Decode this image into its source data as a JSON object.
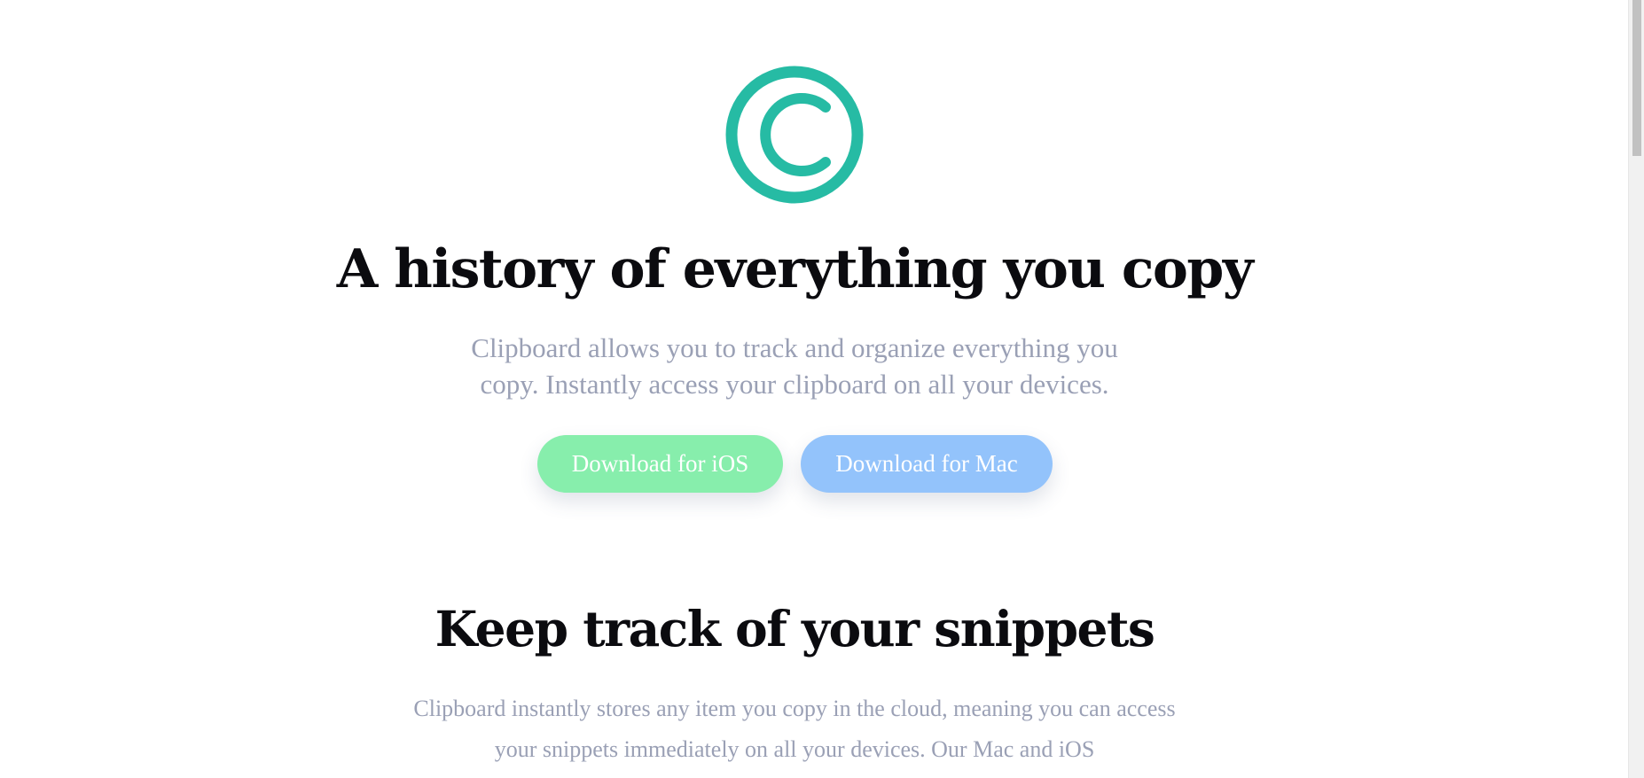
{
  "hero": {
    "logo_icon": "copyright-c-icon",
    "logo_color": "#26bba4",
    "title": "A history of everything you copy",
    "subtitle": "Clipboard allows you to track and organize everything you copy. Instantly access your clipboard on all your devices.",
    "buttons": {
      "ios_label": "Download for iOS",
      "mac_label": "Download for Mac",
      "ios_color": "#87eeac",
      "mac_color": "#93c3fb"
    }
  },
  "section": {
    "title": "Keep track of your snippets",
    "text": "Clipboard instantly stores any item you copy in the cloud, meaning you can access your snippets immediately on all your devices. Our Mac and iOS"
  },
  "colors": {
    "heading": "#0b0b0f",
    "body_text": "#9aa0b5",
    "background": "#ffffff"
  }
}
